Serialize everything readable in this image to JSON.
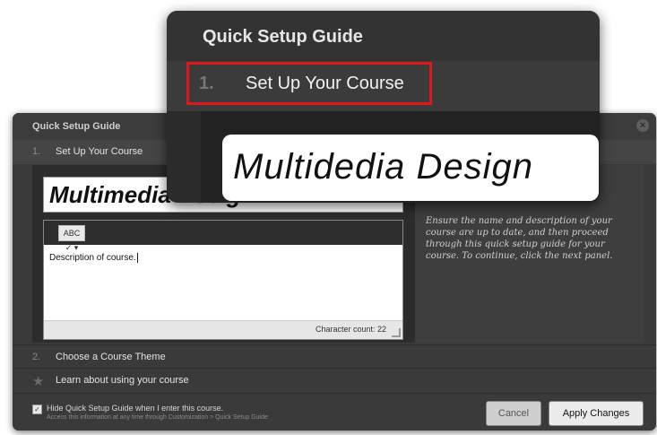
{
  "dialog": {
    "title": "Quick Setup Guide",
    "close_glyph": "×",
    "steps": [
      {
        "number": "1.",
        "label": "Set Up Your Course"
      },
      {
        "number": "2.",
        "label": "Choose a Course Theme"
      },
      {
        "number": "",
        "label": "Learn about using your course"
      }
    ],
    "course_name": "Multimedia Design",
    "editor": {
      "spell_label": "ABC ✓ ▾",
      "description": "Description of course.",
      "char_count": "Character count: 22"
    },
    "help_text": "Ensure the name and description of your course are up to date, and then proceed through this quick setup guide for your course. To continue, click the next panel.",
    "footer": {
      "checkbox_checked": true,
      "hide_label": "Hide Quick Setup Guide when I enter this course.",
      "hint": "Access this information at any time through Customization > Quick Setup Guide"
    },
    "buttons": {
      "cancel": "Cancel",
      "apply": "Apply Changes"
    }
  },
  "callout": {
    "title": "Quick Setup Guide",
    "step_number": "1.",
    "step_label": "Set Up Your Course",
    "course_name": "Multidedia Design",
    "highlight_color": "#e0161d"
  }
}
